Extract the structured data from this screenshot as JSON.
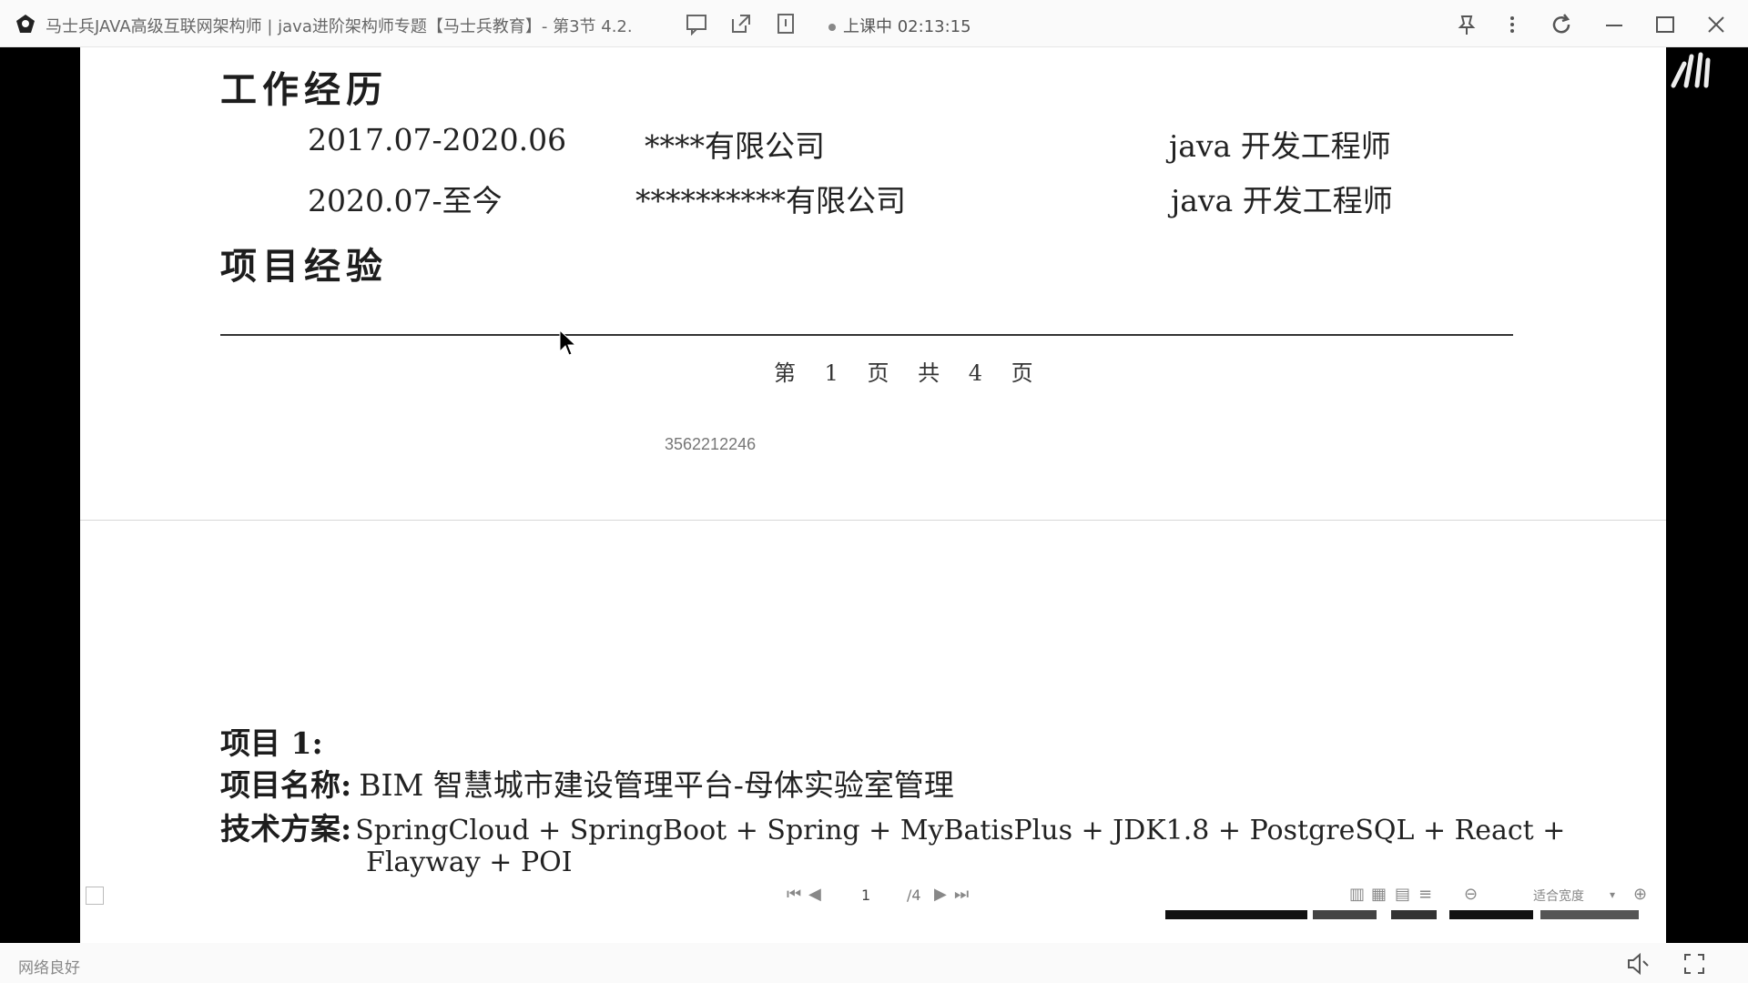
{
  "titlebar": {
    "title": "马士兵JAVA高级互联网架构师 | java进阶架构师专题【马士兵教育】- 第3节 4.2.",
    "status": "上课中 02:13:15"
  },
  "document": {
    "work_heading": "工作经历",
    "jobs": [
      {
        "period": "2017.07-2020.06",
        "company": "****有限公司",
        "title": "java 开发工程师"
      },
      {
        "period": "2020.07-至今",
        "company": "**********有限公司",
        "title": "java 开发工程师"
      }
    ],
    "project_heading": "项目经验",
    "page_footer": "第 1 页 共 4 页",
    "page_id": "3562212246",
    "project_index": "项目 1:",
    "project_name_label": "项目名称:",
    "project_name_value": "BIM 智慧城市建设管理平台-母体实验室管理",
    "tech_label": "技术方案:",
    "tech_line1": "SpringCloud + SpringBoot + Spring + MyBatisPlus + JDK1.8 + PostgreSQL + React +",
    "tech_line2": "Flayway + POI"
  },
  "pdf_toolbar": {
    "current_page": "1",
    "total_pages": "/4",
    "zoom": "适合宽度"
  },
  "bottombar": {
    "network_status": "网络良好"
  },
  "icons": {
    "app_logo": "app-logo-icon",
    "comment": "comment-icon",
    "external": "open-external-icon",
    "info": "info-icon",
    "pin": "pin-icon",
    "more": "more-icon",
    "refresh": "refresh-icon",
    "minimize": "minimize-icon",
    "maximize": "maximize-icon",
    "close": "close-icon",
    "volume": "volume-icon",
    "fullscreen": "fullscreen-icon"
  }
}
